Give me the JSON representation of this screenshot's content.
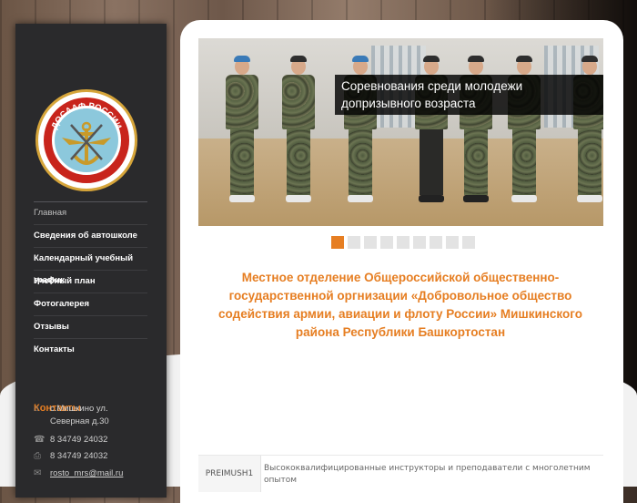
{
  "sidebar": {
    "logo_text": "ДОСААФ РОССИИ",
    "nav": [
      {
        "label": "Главная",
        "active": true
      },
      {
        "label": "Сведения об автошколе"
      },
      {
        "label": "Календарный учебный график"
      },
      {
        "label": "Учебный план"
      },
      {
        "label": "Фотогалерея"
      },
      {
        "label": "Отзывы"
      },
      {
        "label": "Контакты"
      }
    ],
    "contacts_title": "Контакты",
    "contacts": {
      "address_line1": "с.Мишкино ул.",
      "address_line2": "Северная д.30",
      "phone": "8 34749 24032",
      "fax": "8 34749 24032",
      "email": "rosto_mrs@mail.ru"
    }
  },
  "slider": {
    "caption_line1": "Соревнования среди молодежи",
    "caption_line2": "допризывного возраста",
    "slide_count": 9,
    "active_slide": 1
  },
  "main": {
    "org_title": "Местное отделение Общероссийской общественно-государственной оргнизации «Добровольное общество содействия армии, авиации и флоту России» Мишкинского района Республики Башкортостан"
  },
  "preimushestva": {
    "tag": "PREIMUSH1",
    "text": "Высококвалифицированные инструкторы и преподаватели с многолетним опытом"
  },
  "colors": {
    "accent": "#e67e22",
    "sidebar_bg": "#2a2a2c"
  }
}
